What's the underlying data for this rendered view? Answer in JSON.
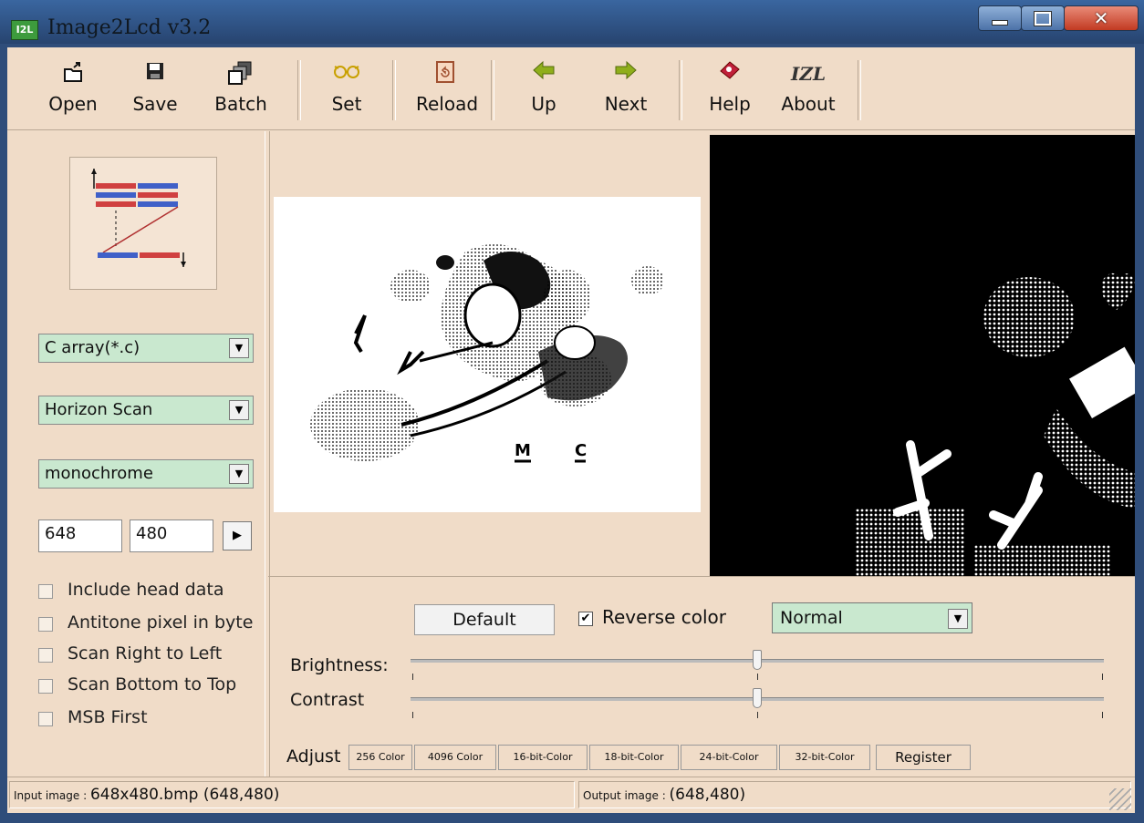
{
  "window": {
    "app_icon_text": "I2L",
    "title": "Image2Lcd v3.2"
  },
  "toolbar": {
    "open": "Open",
    "save": "Save",
    "batch": "Batch",
    "set": "Set",
    "reload": "Reload",
    "up": "Up",
    "next": "Next",
    "help": "Help",
    "about": "About",
    "about_glyph": "IZL"
  },
  "left": {
    "output_type": "C array(*.c)",
    "scan_mode": "Horizon Scan",
    "color_depth": "monochrome",
    "width": "648",
    "height": "480",
    "options": [
      "Include head data",
      "Antitone pixel in byte",
      "Scan Right to Left",
      "Scan Bottom to Top",
      "MSB First"
    ]
  },
  "preview": {
    "input_text_m": "M",
    "input_text_c": "C"
  },
  "adjust": {
    "default_label": "Default",
    "reverse_color_label": "Reverse color",
    "reverse_color_checked": "✔",
    "mode": "Normal",
    "brightness_label": "Brightness:",
    "contrast_label": "Contrast",
    "brightness_level": 0.5,
    "contrast_level": 0.5
  },
  "tabs": [
    "Adjust",
    "256 Color",
    "4096 Color",
    "16-bit-Color",
    "18-bit-Color",
    "24-bit-Color",
    "32-bit-Color",
    "Register"
  ],
  "status": {
    "input_prefix": "Input image : ",
    "input_value": "648x480.bmp (648,480)",
    "output_prefix": "Output image : ",
    "output_value": "(648,480)"
  }
}
